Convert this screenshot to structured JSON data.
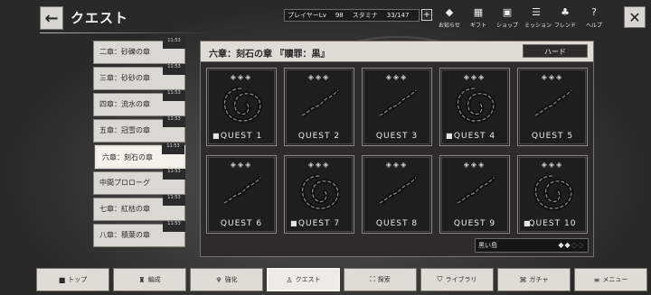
{
  "header": {
    "title": "クエスト",
    "player_level_label": "プレイヤーLv",
    "player_level": "98",
    "stamina_label": "スタミナ",
    "stamina": "33/147",
    "icons": [
      {
        "icon": "bell-icon",
        "glyph": "◆",
        "label": "お知らせ"
      },
      {
        "icon": "gift-icon",
        "glyph": "▦",
        "label": "ギフト"
      },
      {
        "icon": "shop-icon",
        "glyph": "▣",
        "label": "ショップ"
      },
      {
        "icon": "mission-icon",
        "glyph": "☰",
        "label": "ミッション"
      },
      {
        "icon": "friend-icon",
        "glyph": "♣",
        "label": "フレンド"
      },
      {
        "icon": "help-icon",
        "glyph": "?",
        "label": "ヘルプ"
      }
    ]
  },
  "chapters": [
    {
      "label": "二章：砂礫の章",
      "reward": "11:53"
    },
    {
      "label": "三章：砂砂の章",
      "reward": "11:53"
    },
    {
      "label": "四章：流水の章",
      "reward": "11:53"
    },
    {
      "label": "五章：冠雪の章",
      "reward": "11:53"
    },
    {
      "label": "六章：刻石の章",
      "reward": "11:53",
      "selected": true
    },
    {
      "label": "中間プロローグ",
      "reward": "11:53"
    },
    {
      "label": "七章：紅枯の章",
      "reward": "11:53"
    },
    {
      "label": "八章：積葉の章",
      "reward": "11:53"
    }
  ],
  "panel": {
    "title": "六章：刻石の章 『贖罪：黒』",
    "hard_label": "ハード",
    "legend_label": "黒い島"
  },
  "quests": [
    {
      "label": "QUEST 1",
      "stars": "◈◈◈",
      "icon": "coiled-chain-icon",
      "book": true
    },
    {
      "label": "QUEST 2",
      "stars": "◈◈◈",
      "icon": "chain-icon",
      "book": false
    },
    {
      "label": "QUEST 3",
      "stars": "◈◈◈",
      "icon": "chain-icon",
      "book": false
    },
    {
      "label": "QUEST 4",
      "stars": "◈◈◈",
      "icon": "coiled-chain-icon",
      "book": true
    },
    {
      "label": "QUEST 5",
      "stars": "◈◈◈",
      "icon": "chain-icon",
      "book": false
    },
    {
      "label": "QUEST 6",
      "stars": "◈◈◈",
      "icon": "chain-icon",
      "book": false
    },
    {
      "label": "QUEST 7",
      "stars": "◈◈◈",
      "icon": "coiled-chain-icon",
      "book": true
    },
    {
      "label": "QUEST 8",
      "stars": "◈◈◈",
      "icon": "chain-icon",
      "book": false
    },
    {
      "label": "QUEST 9",
      "stars": "◈◈◈",
      "icon": "chain-icon",
      "book": false
    },
    {
      "label": "QUEST 10",
      "stars": "◈◈◈",
      "icon": "coiled-chain-icon",
      "book": true
    }
  ],
  "nav": [
    {
      "label": "トップ",
      "icon": "home-icon",
      "glyph": "■"
    },
    {
      "label": "編成",
      "icon": "formation-icon",
      "glyph": "♜"
    },
    {
      "label": "強化",
      "icon": "upgrade-icon",
      "glyph": "♆"
    },
    {
      "label": "クエスト",
      "icon": "quest-icon",
      "glyph": "♙",
      "active": true
    },
    {
      "label": "探索",
      "icon": "explore-icon",
      "glyph": "⛶"
    },
    {
      "label": "ライブラリ",
      "icon": "library-icon",
      "glyph": "⛉"
    },
    {
      "label": "ガチャ",
      "icon": "gacha-icon",
      "glyph": "⌘"
    },
    {
      "label": "メニュー",
      "icon": "menu-icon",
      "glyph": "≡"
    }
  ],
  "colors": {
    "panel_bg": "#2d2c2a",
    "header_bg": "#dedcd5",
    "tile_bg": "#1e1e1d"
  }
}
